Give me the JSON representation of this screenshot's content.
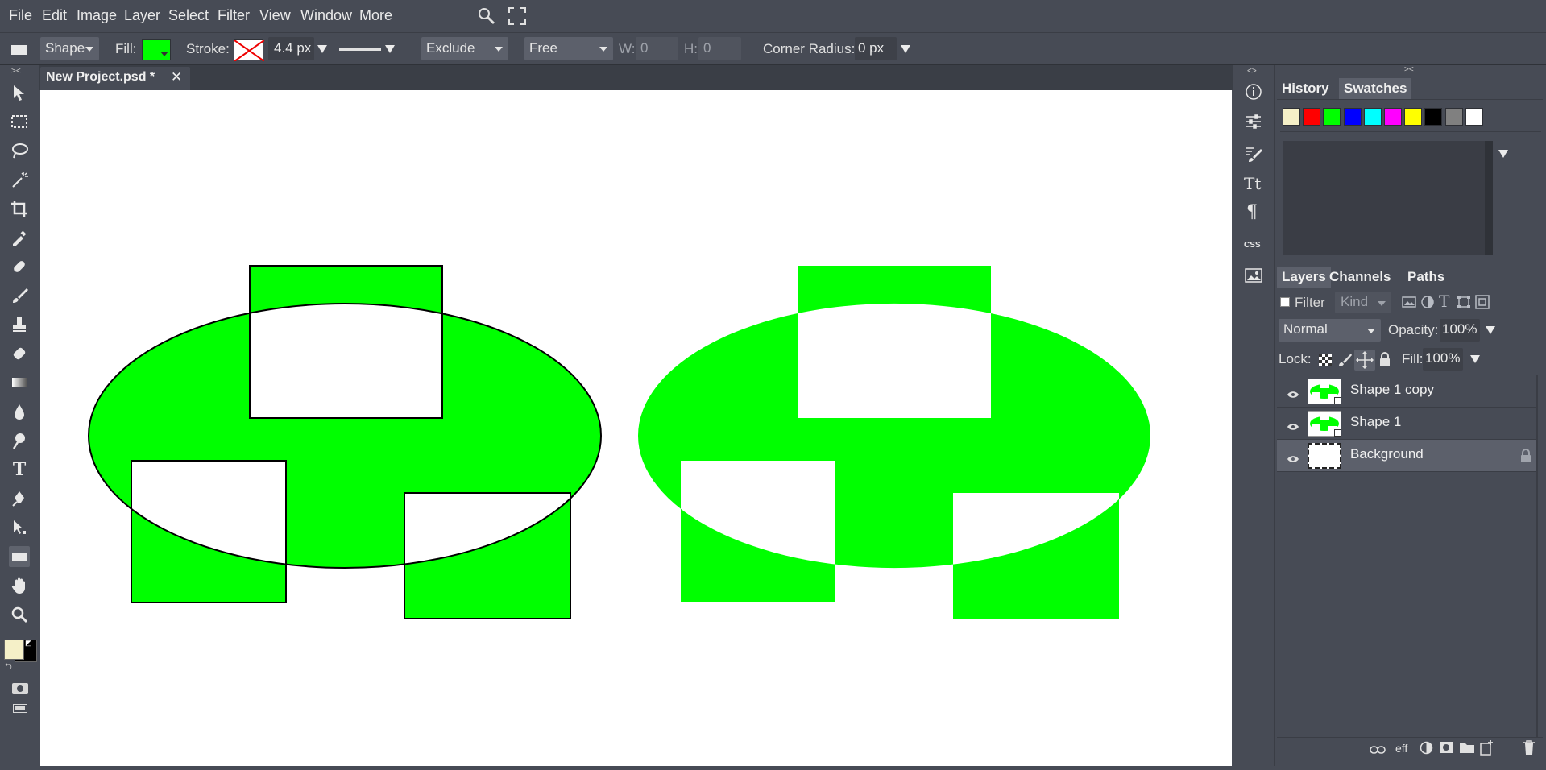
{
  "menubar": {
    "items": [
      "File",
      "Edit",
      "Image",
      "Layer",
      "Select",
      "Filter",
      "View",
      "Window",
      "More"
    ]
  },
  "options": {
    "mode": "Shape",
    "fill_label": "Fill:",
    "fill_color": "#00ff00",
    "stroke_label": "Stroke:",
    "stroke_width": "4.4 px",
    "combine": "Exclude",
    "constraint": "Free",
    "w_label": "W:",
    "w_value": "0",
    "h_label": "H:",
    "h_value": "0",
    "radius_label": "Corner Radius:",
    "radius_value": "0 px"
  },
  "document": {
    "tab_title": "New Project.psd *",
    "close": "✕"
  },
  "colors": {
    "shape_fill": "#00ff00",
    "foreground": "#f5f0c8",
    "background": "#000000"
  },
  "panels": {
    "top_tabs": [
      "History",
      "Swatches"
    ],
    "swatches": [
      "#f5f0c8",
      "#ff0000",
      "#00ff00",
      "#0000ff",
      "#00ffff",
      "#ff00ff",
      "#ffff00",
      "#000000",
      "#808080",
      "#ffffff"
    ],
    "layer_tabs": [
      "Layers",
      "Channels",
      "Paths"
    ],
    "filter_label": "Filter",
    "kind_placeholder": "Kind",
    "blend_mode": "Normal",
    "opacity_label": "Opacity:",
    "opacity_value": "100%",
    "lock_label": "Lock:",
    "fill_label": "Fill:",
    "fill_value": "100%",
    "layers": [
      {
        "name": "Shape 1 copy"
      },
      {
        "name": "Shape 1"
      },
      {
        "name": "Background"
      }
    ],
    "bottom_eff": "eff"
  },
  "iconstrip": {
    "css_label": "CSS"
  }
}
